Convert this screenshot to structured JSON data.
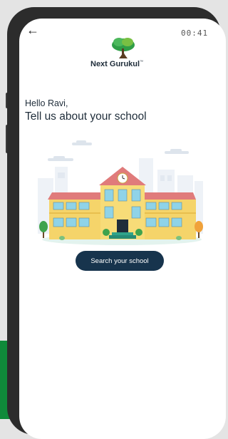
{
  "status_bar": {
    "time": "00:41"
  },
  "logo": {
    "text": "Next Gurukul",
    "trademark": "™"
  },
  "main": {
    "greeting": "Hello Ravi,",
    "heading": "Tell us about your school",
    "search_button_label": "Search your school"
  },
  "icons": {
    "back": "back-arrow-icon"
  },
  "colors": {
    "button_bg": "#17344d",
    "text_dark": "#1f2d3a",
    "school_wall": "#f5d46a",
    "school_roof": "#e07b7b",
    "background_band": "#0f8a3a"
  }
}
